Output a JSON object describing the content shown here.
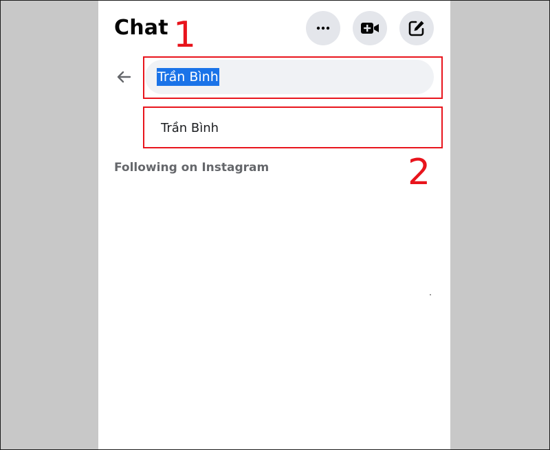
{
  "header": {
    "title": "Chat",
    "buttons": {
      "more": "more-icon",
      "video": "video-plus-icon",
      "compose": "compose-icon"
    }
  },
  "search": {
    "back_icon": "arrow-left-icon",
    "value": "Trần Bình"
  },
  "results": [
    {
      "label": "Trần Bình"
    }
  ],
  "sections": {
    "following_heading": "Following on Instagram"
  },
  "annotations": {
    "step1": "1",
    "step2": "2",
    "color": "#e8141c"
  },
  "colors": {
    "selection": "#1a73e8",
    "panel_bg": "#ffffff",
    "backdrop": "#c8c8c8",
    "button_bg": "#e4e6eb",
    "search_bg": "#f0f2f5"
  }
}
